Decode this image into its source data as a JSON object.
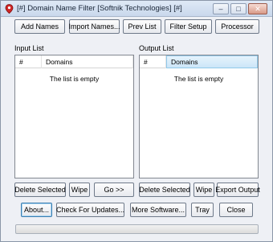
{
  "window": {
    "title": "[#] Domain Name Filter [Softnik Technologies] [#]"
  },
  "title_buttons": {
    "minimize": "–",
    "maximize": "□",
    "close": "✕"
  },
  "toolbar": {
    "add_names": "Add Names",
    "import_names": "Import Names...",
    "prev_list": "Prev List",
    "filter_setup": "Filter Setup",
    "processor": "Processor"
  },
  "input_list": {
    "label": "Input List",
    "col_num": "#",
    "col_domains": "Domains",
    "empty_text": "The list is empty",
    "delete_selected": "Delete Selected",
    "wipe": "Wipe",
    "go": "Go >>"
  },
  "output_list": {
    "label": "Output List",
    "col_num": "#",
    "col_domains": "Domains",
    "empty_text": "The list is empty",
    "delete_selected": "Delete Selected",
    "wipe": "Wipe",
    "export_output": "Export Output"
  },
  "footer": {
    "about": "About...",
    "check_updates": "Check For Updates...",
    "more_software": "More Software...",
    "tray": "Tray",
    "close": "Close"
  },
  "progress": {
    "value": 0
  }
}
